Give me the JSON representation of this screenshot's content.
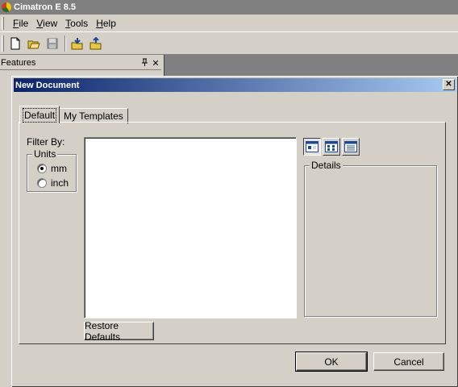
{
  "app": {
    "title": "Cimatron E 8.5"
  },
  "menu": [
    {
      "accel": "F",
      "rest": "ile"
    },
    {
      "accel": "V",
      "rest": "iew"
    },
    {
      "accel": "T",
      "rest": "ools"
    },
    {
      "accel": "H",
      "rest": "elp"
    }
  ],
  "toolbar": {
    "icons": [
      "new-document-icon",
      "open-folder-icon",
      "save-disk-icon",
      "import-icon",
      "export-icon"
    ]
  },
  "features_panel": {
    "title": "Features",
    "pin": "1",
    "close": "✕"
  },
  "dialog": {
    "title": "New Document",
    "close_glyph": "✕",
    "tabs": [
      "Default",
      "My Templates"
    ],
    "filter_by": "Filter By:",
    "units": {
      "legend": "Units",
      "options": [
        "mm",
        "inch"
      ],
      "selected": "mm"
    },
    "view_buttons": [
      "large-icons-view-icon",
      "small-icons-view-icon",
      "details-view-icon"
    ],
    "details_label": "Details",
    "restore_defaults": "Restore Defaults",
    "ok": "OK",
    "cancel": "Cancel"
  }
}
